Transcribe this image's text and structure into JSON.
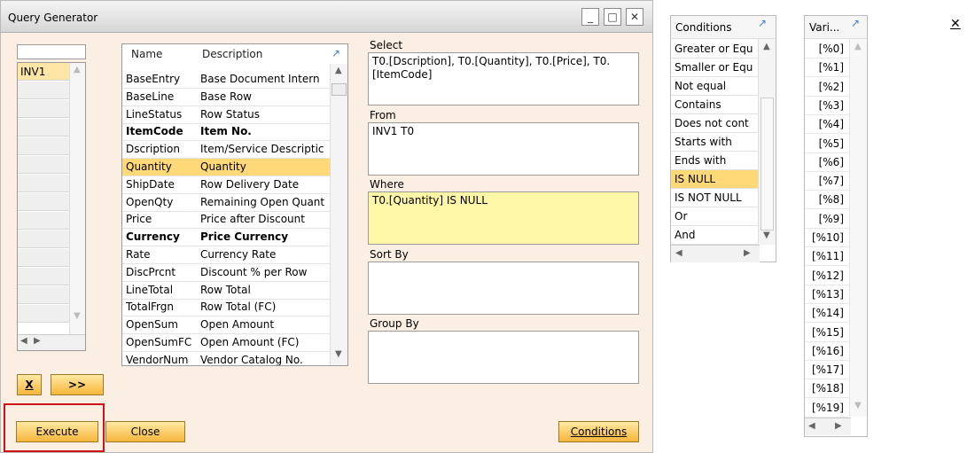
{
  "window": {
    "title": "Query Generator",
    "minimize": "_",
    "maximize": "□",
    "close": "✕"
  },
  "tables": {
    "search_value": "",
    "rows": [
      "INV1"
    ]
  },
  "fields": {
    "col_name": "Name",
    "col_desc": "Description",
    "rows": [
      {
        "name": "BaseEntry",
        "desc": "Base Document Intern"
      },
      {
        "name": "BaseLine",
        "desc": "Base Row"
      },
      {
        "name": "LineStatus",
        "desc": "Row Status"
      },
      {
        "name": "ItemCode",
        "desc": "Item No.",
        "bold": true
      },
      {
        "name": "Dscription",
        "desc": "Item/Service Descriptic"
      },
      {
        "name": "Quantity",
        "desc": "Quantity",
        "selected": true
      },
      {
        "name": "ShipDate",
        "desc": "Row Delivery Date"
      },
      {
        "name": "OpenQty",
        "desc": "Remaining Open Quant"
      },
      {
        "name": "Price",
        "desc": "Price after Discount"
      },
      {
        "name": "Currency",
        "desc": "Price Currency",
        "bold": true
      },
      {
        "name": "Rate",
        "desc": "Currency Rate"
      },
      {
        "name": "DiscPrcnt",
        "desc": "Discount % per Row"
      },
      {
        "name": "LineTotal",
        "desc": "Row Total"
      },
      {
        "name": "TotalFrgn",
        "desc": "Row Total (FC)"
      },
      {
        "name": "OpenSum",
        "desc": "Open Amount"
      },
      {
        "name": "OpenSumFC",
        "desc": "Open Amount (FC)"
      },
      {
        "name": "VendorNum",
        "desc": "Vendor Catalog No."
      }
    ]
  },
  "sections": {
    "select_label": "Select",
    "select_text": "T0.[Dscription], T0.[Quantity], T0.[Price], T0.[ItemCode]",
    "from_label": "From",
    "from_text": "INV1 T0",
    "where_label": "Where",
    "where_text": "T0.[Quantity] IS NULL",
    "sortby_label": "Sort By",
    "sortby_text": "",
    "groupby_label": "Group By",
    "groupby_text": ""
  },
  "buttons": {
    "remove": "X",
    "add": ">>",
    "execute": "Execute",
    "close": "Close",
    "conditions": "Conditions"
  },
  "conditions": {
    "header": "Conditions",
    "rows": [
      "Greater or Equ",
      "Smaller or Equ",
      "Not equal",
      "Contains",
      "Does not cont",
      "Starts with",
      "Ends with",
      "IS NULL",
      "IS NOT NULL",
      "Or",
      "And"
    ],
    "selected_index": 7
  },
  "variables": {
    "header": "Vari...",
    "close": "✕",
    "rows": [
      "[%0]",
      "[%1]",
      "[%2]",
      "[%3]",
      "[%4]",
      "[%5]",
      "[%6]",
      "[%7]",
      "[%8]",
      "[%9]",
      "[%10]",
      "[%11]",
      "[%12]",
      "[%13]",
      "[%14]",
      "[%15]",
      "[%16]",
      "[%17]",
      "[%18]",
      "[%19]"
    ]
  },
  "colors": {
    "accent": "#f6b63b",
    "selected_row": "#ffd978",
    "where_bg": "#fff7a8",
    "highlight": "#d0121b"
  }
}
